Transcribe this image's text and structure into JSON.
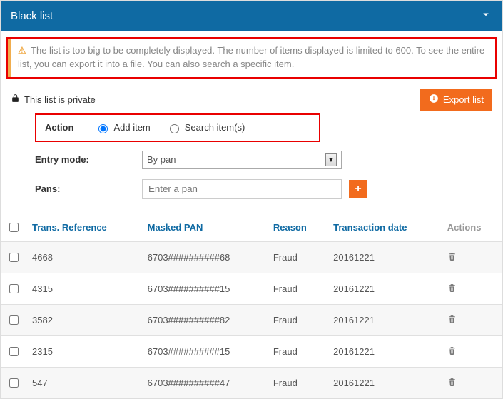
{
  "panel": {
    "title": "Black list"
  },
  "alert": {
    "text": "The list is too big to be completely displayed. The number of items displayed is limited to 600. To see the entire list, you can export it into a file. You can also search a specific item."
  },
  "private_label": "This list is private",
  "export_label": "Export list",
  "form": {
    "action_label": "Action",
    "radio_add": "Add item",
    "radio_search": "Search item(s)",
    "entry_mode_label": "Entry mode:",
    "entry_mode_value": "By pan",
    "pans_label": "Pans:",
    "pans_placeholder": "Enter a pan"
  },
  "columns": {
    "ref": "Trans. Reference",
    "pan": "Masked PAN",
    "reason": "Reason",
    "date": "Transaction date",
    "actions": "Actions"
  },
  "rows": [
    {
      "ref": "4668",
      "pan": "6703##########68",
      "reason": "Fraud",
      "date": "20161221"
    },
    {
      "ref": "4315",
      "pan": "6703##########15",
      "reason": "Fraud",
      "date": "20161221"
    },
    {
      "ref": "3582",
      "pan": "6703##########82",
      "reason": "Fraud",
      "date": "20161221"
    },
    {
      "ref": "2315",
      "pan": "6703##########15",
      "reason": "Fraud",
      "date": "20161221"
    },
    {
      "ref": "547",
      "pan": "6703##########47",
      "reason": "Fraud",
      "date": "20161221"
    }
  ]
}
